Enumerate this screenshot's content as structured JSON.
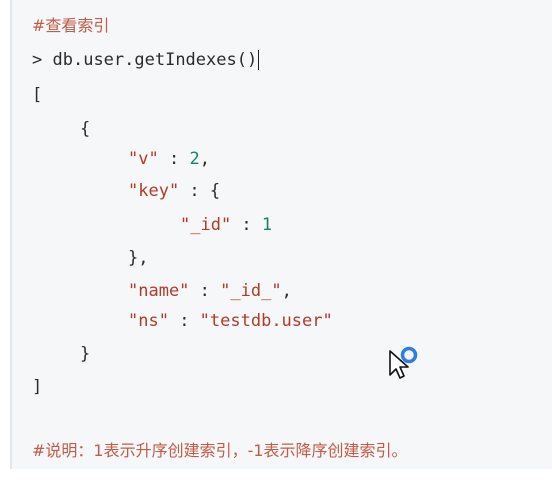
{
  "comment_top": "#查看索引",
  "command": {
    "prompt": ">",
    "text": "db.user.getIndexes()"
  },
  "output": {
    "open_bracket": "[",
    "open_brace": "{",
    "v_key": "\"v\"",
    "v_sep": " : ",
    "v_val": "2",
    "comma": ",",
    "key_key": "\"key\"",
    "key_sep": " : ",
    "key_open": "{",
    "id_key": "\"_id\"",
    "id_sep": " : ",
    "id_val": "1",
    "inner_close": "},",
    "name_key": "\"name\"",
    "name_sep": " : ",
    "name_val": "\"_id_\"",
    "ns_key": "\"ns\"",
    "ns_sep": " : ",
    "ns_val": "\"testdb.user\"",
    "close_brace": "}",
    "close_bracket": "]"
  },
  "comment_bottom": "#说明：1表示升序创建索引，-1表示降序创建索引。",
  "colors": {
    "comment": "#c25b47",
    "string": "#b03b2a",
    "number": "#1a7f6b",
    "background": "#f6f7f9",
    "cursor_ring": "#2f7fe0"
  },
  "icons": {
    "cursor": "mouse-pointer-with-loading-ring-icon"
  }
}
